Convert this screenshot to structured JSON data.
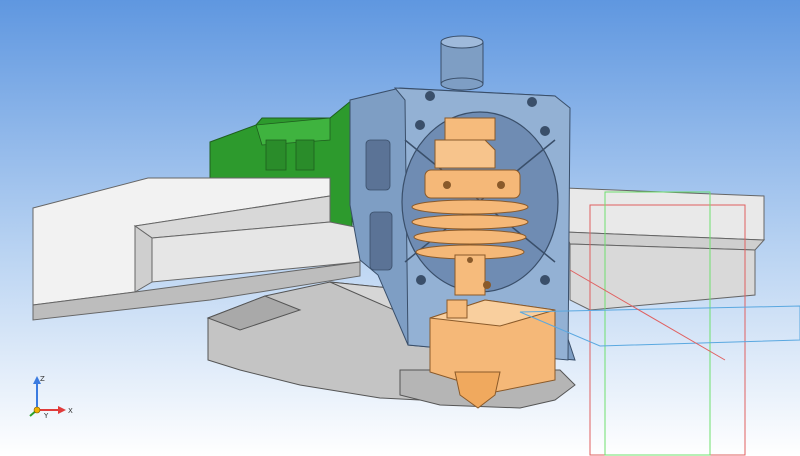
{
  "viewport": {
    "background_top": "#5f97e0",
    "background_bottom": "#ffffff"
  },
  "colors": {
    "rail": "#dcdcdc",
    "rail_face": "#f4f4f4",
    "housing": "#c7c7c7",
    "bracket": "#8ba9cc",
    "heatsink": "#f5b878",
    "mount": "#2d9a2d",
    "sketch_red": "#e06060",
    "sketch_green": "#6ee06e",
    "sketch_blue": "#5aa8e0"
  },
  "axes": {
    "x_label": "X",
    "y_label": "Y",
    "z_label": "Z"
  }
}
